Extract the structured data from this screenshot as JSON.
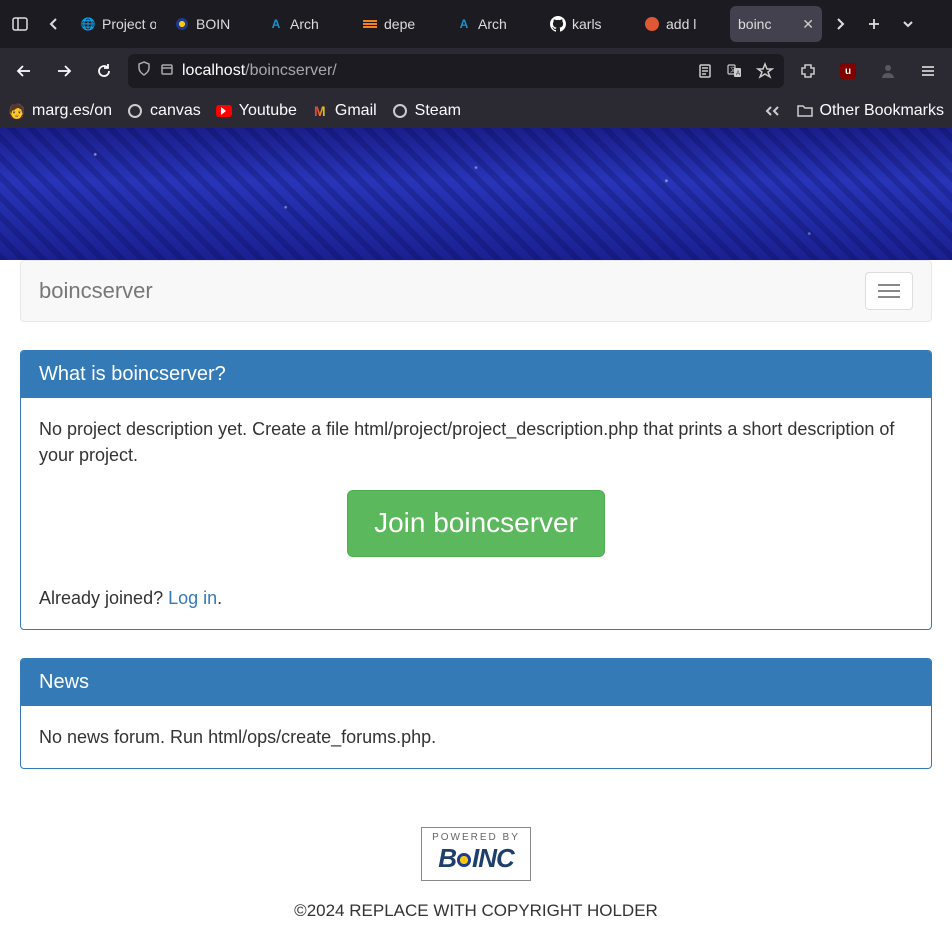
{
  "tabs": [
    {
      "label": "Project o"
    },
    {
      "label": "BOIN"
    },
    {
      "label": "Arch"
    },
    {
      "label": "depe"
    },
    {
      "label": "Arch"
    },
    {
      "label": "karls"
    },
    {
      "label": "add l"
    },
    {
      "label": "boinc",
      "active": true
    }
  ],
  "url": {
    "host": "localhost",
    "path": "/boincserver/"
  },
  "bookmarks": [
    {
      "label": "marg.es/on"
    },
    {
      "label": "canvas"
    },
    {
      "label": "Youtube"
    },
    {
      "label": "Gmail"
    },
    {
      "label": "Steam"
    }
  ],
  "other_bookmarks": "Other Bookmarks",
  "page": {
    "brand": "boincserver",
    "panel1": {
      "title": "What is boincserver?",
      "desc": "No project description yet. Create a file html/project/project_description.php that prints a short description of your project.",
      "join": "Join boincserver",
      "already": "Already joined? ",
      "login": "Log in",
      "period": "."
    },
    "panel2": {
      "title": "News",
      "body": "No news forum. Run html/ops/create_forums.php."
    },
    "powered": "POWERED BY",
    "boinc": "B   INC",
    "copyright": "©2024 REPLACE WITH COPYRIGHT HOLDER"
  }
}
